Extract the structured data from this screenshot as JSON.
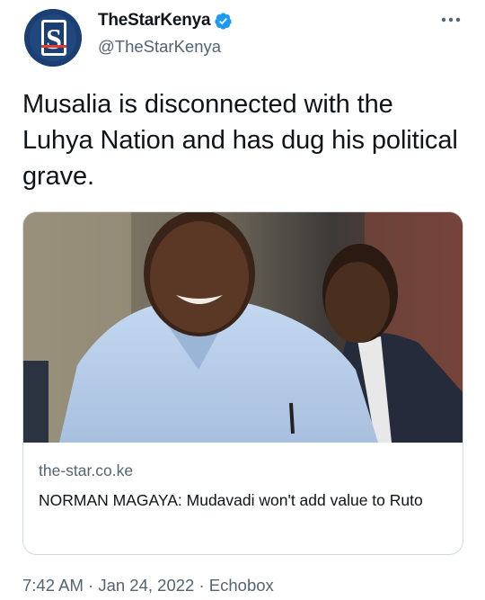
{
  "author": {
    "display_name": "TheStarKenya",
    "handle": "@TheStarKenya",
    "avatar_letter": "S",
    "verified": true
  },
  "tweet": {
    "text": "Musalia is disconnected with the Luhya Nation and has dug his political grave."
  },
  "card": {
    "domain": "the-star.co.ke",
    "title": "NORMAN MAGAYA: Mudavadi won't add value to Ruto"
  },
  "meta": {
    "time": "7:42 AM",
    "separator": "·",
    "date": "Jan 24, 2022",
    "source": "Echobox"
  },
  "colors": {
    "verified_blue": "#1d9bf0",
    "avatar_bg": "#1b3f73",
    "secondary_text": "#536471"
  },
  "icons": [
    "star-logo-icon",
    "verified-badge-icon",
    "more-options-icon"
  ]
}
